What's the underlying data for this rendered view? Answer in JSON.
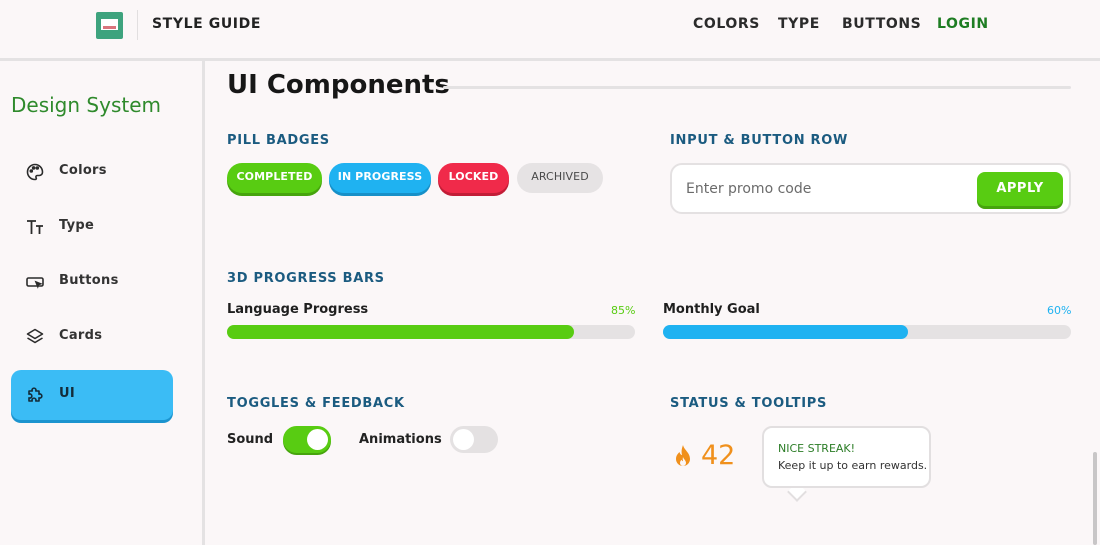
{
  "topbar": {
    "brand": "STYLE GUIDE",
    "nav": [
      {
        "label": "COLORS"
      },
      {
        "label": "TYPE"
      },
      {
        "label": "BUTTONS"
      },
      {
        "label": "LOGIN"
      }
    ]
  },
  "sidebar": {
    "title": "Design System",
    "items": [
      {
        "label": "Colors",
        "icon": "palette-icon"
      },
      {
        "label": "Type",
        "icon": "text-type-icon"
      },
      {
        "label": "Buttons",
        "icon": "button-cursor-icon"
      },
      {
        "label": "Cards",
        "icon": "layers-icon"
      },
      {
        "label": "UI",
        "icon": "puzzle-icon",
        "active": true
      }
    ]
  },
  "main": {
    "title": "UI Components",
    "pill_badges": {
      "heading": "PILL BADGES",
      "badges": [
        {
          "label": "COMPLETED",
          "color": "#58cc12"
        },
        {
          "label": "IN PROGRESS",
          "color": "#1fb2f1"
        },
        {
          "label": "LOCKED",
          "color": "#f02a4a"
        },
        {
          "label": "ARCHIVED",
          "color": "#e6e3e4"
        }
      ]
    },
    "input_row": {
      "heading": "INPUT & BUTTON ROW",
      "placeholder": "Enter promo code",
      "value": "",
      "button_label": "APPLY"
    },
    "progress": {
      "heading": "3D PROGRESS BARS",
      "bars": [
        {
          "label": "Language Progress",
          "percent_text": "85%",
          "value": 0.85,
          "color": "#58cc12"
        },
        {
          "label": "Monthly Goal",
          "percent_text": "60%",
          "value": 0.6,
          "color": "#1fb2f1"
        }
      ]
    },
    "toggles": {
      "heading": "TOGGLES & FEEDBACK",
      "items": [
        {
          "label": "Sound",
          "on": true
        },
        {
          "label": "Animations",
          "on": false
        }
      ]
    },
    "status": {
      "heading": "STATUS & TOOLTIPS",
      "streak_count": "42",
      "streak_icon": "flame-icon",
      "tooltip_title": "NICE STREAK!",
      "tooltip_body": "Keep it up to earn rewards."
    }
  }
}
